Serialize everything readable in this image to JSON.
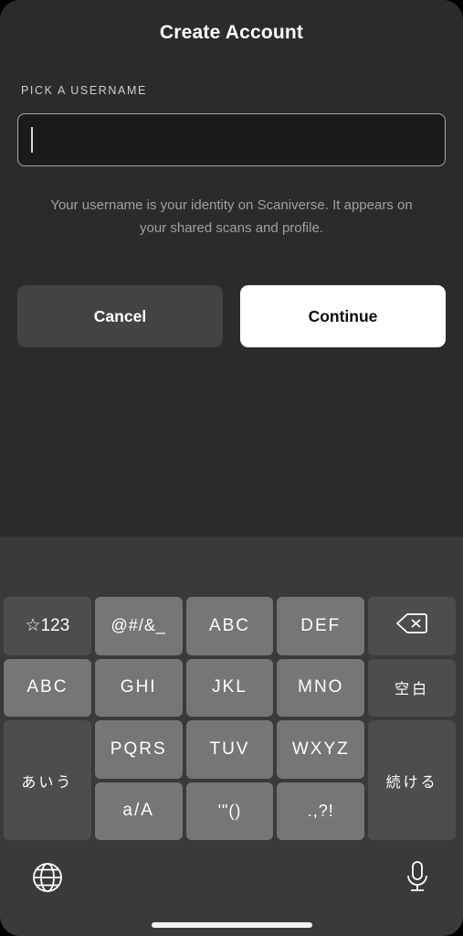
{
  "dialog": {
    "title": "Create Account",
    "field_label": "PICK A USERNAME",
    "username_value": "",
    "username_placeholder": "",
    "helper_text": "Your username is your identity on Scaniverse. It appears on your shared scans and profile.",
    "cancel_label": "Cancel",
    "continue_label": "Continue"
  },
  "colors": {
    "app_background": "#2b2b2b",
    "keyboard_background": "#3a3a3a",
    "key_light": "#767676",
    "key_dark": "#4d4d4d",
    "primary_button": "#ffffff",
    "secondary_button": "#434343",
    "input_border": "#a9a9a9",
    "input_fill": "#1b1b1b",
    "helper_text": "#a0a0a0"
  },
  "keyboard": {
    "layout": "japanese-kana-12key",
    "keys": [
      {
        "id": "sym123",
        "label": "☆123",
        "style": "dark",
        "icon": "star-icon",
        "row": 1,
        "col": 1,
        "rowspan": 1
      },
      {
        "id": "atsign",
        "label": "@#/&_",
        "style": "light",
        "icon": null,
        "row": 1,
        "col": 2,
        "rowspan": 1
      },
      {
        "id": "abc-def1",
        "label": "ABC",
        "style": "light",
        "icon": null,
        "row": 1,
        "col": 3,
        "rowspan": 1
      },
      {
        "id": "def",
        "label": "DEF",
        "style": "light",
        "icon": null,
        "row": 1,
        "col": 4,
        "rowspan": 1
      },
      {
        "id": "backspace",
        "label": "",
        "style": "dark",
        "icon": "backspace-icon",
        "row": 1,
        "col": 5,
        "rowspan": 1
      },
      {
        "id": "abc-mode",
        "label": "ABC",
        "style": "light",
        "icon": null,
        "row": 2,
        "col": 1,
        "rowspan": 1
      },
      {
        "id": "ghi",
        "label": "GHI",
        "style": "light",
        "icon": null,
        "row": 2,
        "col": 2,
        "rowspan": 1
      },
      {
        "id": "jkl",
        "label": "JKL",
        "style": "light",
        "icon": null,
        "row": 2,
        "col": 3,
        "rowspan": 1
      },
      {
        "id": "mno",
        "label": "MNO",
        "style": "light",
        "icon": null,
        "row": 2,
        "col": 4,
        "rowspan": 1
      },
      {
        "id": "space",
        "label": "空白",
        "style": "dark",
        "icon": null,
        "row": 2,
        "col": 5,
        "rowspan": 1
      },
      {
        "id": "kana",
        "label": "あいう",
        "style": "dark",
        "icon": null,
        "row": 3,
        "col": 1,
        "rowspan": 2
      },
      {
        "id": "pqrs",
        "label": "PQRS",
        "style": "light",
        "icon": null,
        "row": 3,
        "col": 2,
        "rowspan": 1
      },
      {
        "id": "tuv",
        "label": "TUV",
        "style": "light",
        "icon": null,
        "row": 3,
        "col": 3,
        "rowspan": 1
      },
      {
        "id": "wxyz",
        "label": "WXYZ",
        "style": "light",
        "icon": null,
        "row": 3,
        "col": 4,
        "rowspan": 1
      },
      {
        "id": "continue-key",
        "label": "続ける",
        "style": "dark",
        "icon": null,
        "row": 3,
        "col": 5,
        "rowspan": 2
      },
      {
        "id": "case",
        "label": "a/A",
        "style": "light",
        "icon": null,
        "row": 4,
        "col": 2,
        "rowspan": 1
      },
      {
        "id": "quotes",
        "label": "'\"()",
        "style": "light",
        "icon": null,
        "row": 4,
        "col": 3,
        "rowspan": 1
      },
      {
        "id": "punct",
        "label": ".,?!",
        "style": "light",
        "icon": null,
        "row": 4,
        "col": 4,
        "rowspan": 1
      }
    ],
    "bottom_bar": {
      "globe_icon": "globe-icon",
      "mic_icon": "microphone-icon",
      "home_indicator": "home-indicator"
    }
  }
}
